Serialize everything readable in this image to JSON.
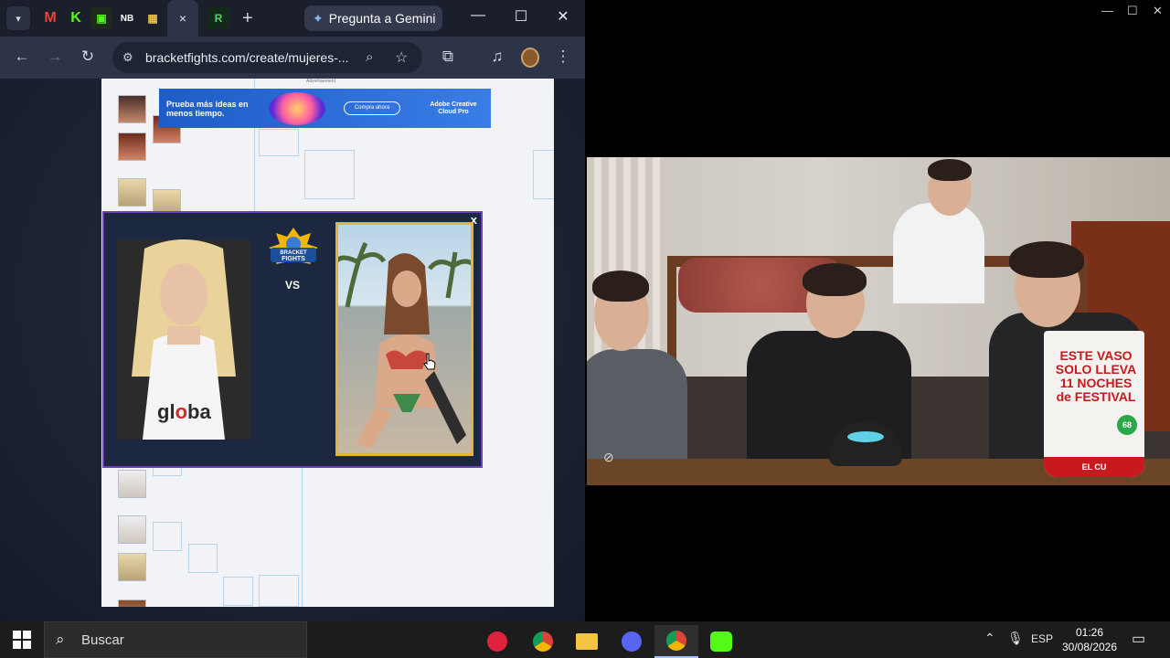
{
  "browser": {
    "tab_list_icon": "chevron-down-icon",
    "active_tab_close": "×",
    "new_tab_label": "+",
    "gemini_label": "Pregunta a Gemini",
    "url": "bracketfights.com/create/mujeres-...",
    "window_controls": {
      "minimize": "—",
      "maximize": "☐",
      "close": "✕"
    }
  },
  "ad": {
    "label": "Advertisement",
    "headline": "Prueba más ideas en menos tiempo.",
    "cta": "Compra ahora",
    "brand": "Adobe Creative Cloud Pro"
  },
  "matchup": {
    "close": "x",
    "logo_line1": "BRACKET",
    "logo_line2": "FIGHTS",
    "vs": "VS",
    "left_shirt_text_a": "gl",
    "left_shirt_text_b": "o",
    "left_shirt_text_c": "ba"
  },
  "webcam": {
    "cup_text": "ESTE VASO SOLO LLEVA 11 NOCHES de FESTIVAL",
    "cup_bottom": "EL CU",
    "cup_badge": "68",
    "window_controls": {
      "minimize": "—",
      "maximize": "☐",
      "close": "✕"
    }
  },
  "taskbar": {
    "search_placeholder": "Buscar",
    "language": "ESP",
    "time": "01:26",
    "date": "30/08/2026"
  },
  "colors": {
    "chrome_bg": "#2d3447",
    "modal_border": "#6a3fbf",
    "selected_border": "#e8b13c",
    "bracket_line": "#b7d4ea"
  }
}
